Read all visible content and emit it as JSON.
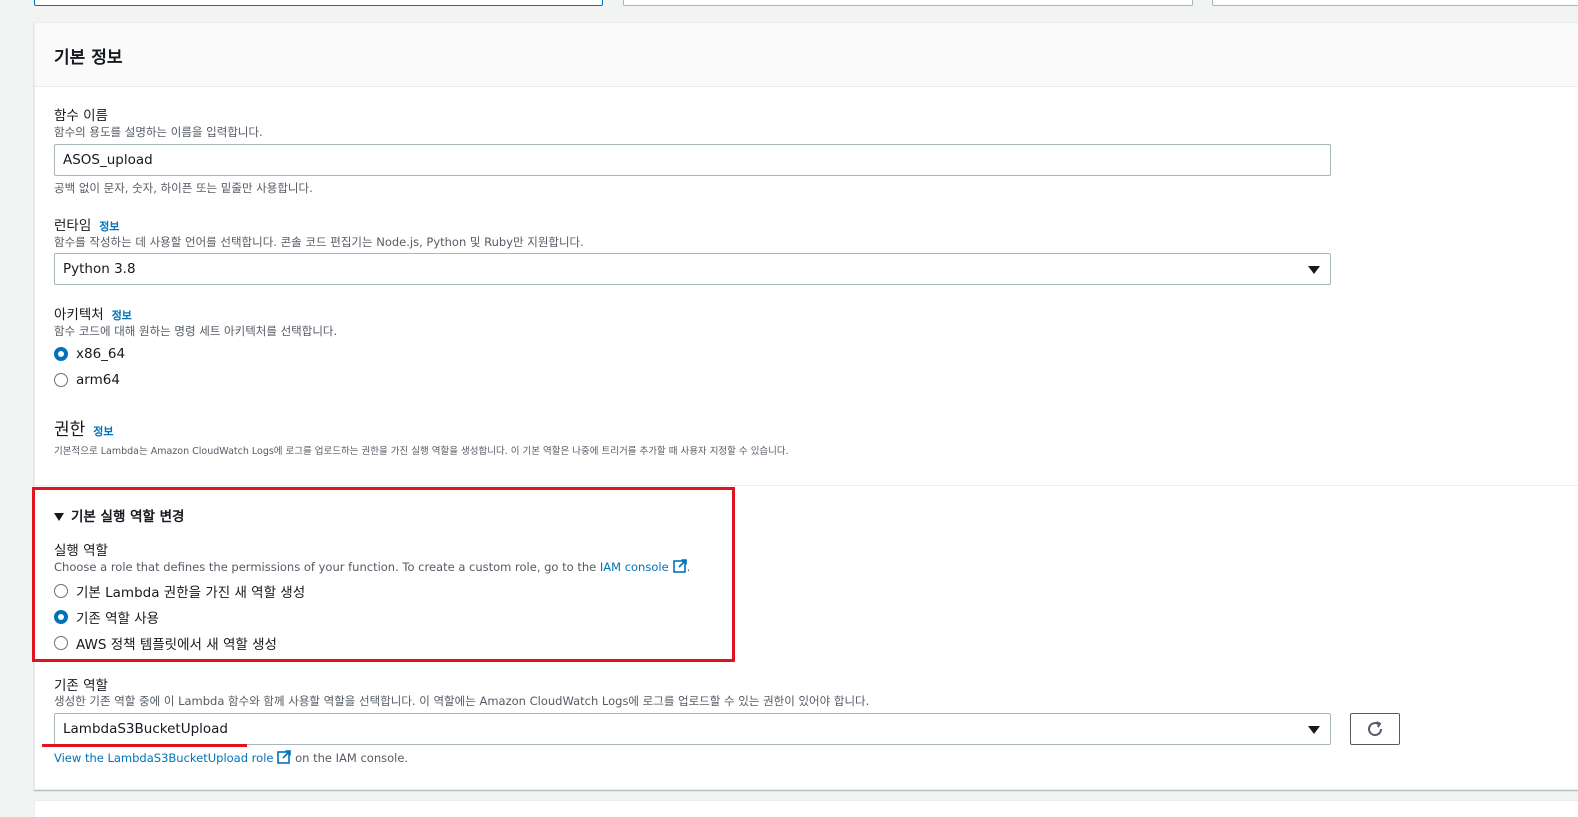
{
  "basic_info": {
    "title": "기본 정보",
    "function_name": {
      "label": "함수 이름",
      "description": "함수의 용도를 설명하는 이름을 입력합니다.",
      "value": "ASOS_upload",
      "hint": "공백 없이 문자, 숫자, 하이픈 또는 밑줄만 사용합니다."
    },
    "runtime": {
      "label": "런타임",
      "info": "정보",
      "description": "함수를 작성하는 데 사용할 언어를 선택합니다. 콘솔 코드 편집기는 Node.js, Python 및 Ruby만 지원합니다.",
      "value": "Python 3.8"
    },
    "architecture": {
      "label": "아키텍처",
      "info": "정보",
      "description": "함수 코드에 대해 원하는 명령 세트 아키텍처를 선택합니다.",
      "options": [
        "x86_64",
        "arm64"
      ],
      "selected": "x86_64"
    }
  },
  "permissions": {
    "title": "권한",
    "info": "정보",
    "description": "기본적으로 Lambda는 Amazon CloudWatch Logs에 로그를 업로드하는 권한을 가진 실행 역할을 생성합니다. 이 기본 역할은 나중에 트리거를 추가할 때 사용자 지정할 수 있습니다.",
    "expander_label": "기본 실행 역할 변경",
    "execution_role": {
      "label": "실행 역할",
      "description_prefix": "Choose a role that defines the permissions of your function. To create a custom role, go to the ",
      "iam_console_link": "IAM console",
      "description_suffix": ".",
      "options": [
        "기본 Lambda 권한을 가진 새 역할 생성",
        "기존 역할 사용",
        "AWS 정책 템플릿에서 새 역할 생성"
      ],
      "selected": "기존 역할 사용"
    },
    "existing_role": {
      "label": "기존 역할",
      "description": "생성한 기존 역할 중에 이 Lambda 함수와 함께 사용할 역할을 선택합니다. 이 역할에는 Amazon CloudWatch Logs에 로그를 업로드할 수 있는 권한이 있어야 합니다.",
      "value": "LambdaS3BucketUpload",
      "view_link": "View the LambdaS3BucketUpload role",
      "view_suffix": " on the IAM console."
    }
  },
  "colors": {
    "accent": "#0073bb",
    "highlight": "#e0141e"
  }
}
